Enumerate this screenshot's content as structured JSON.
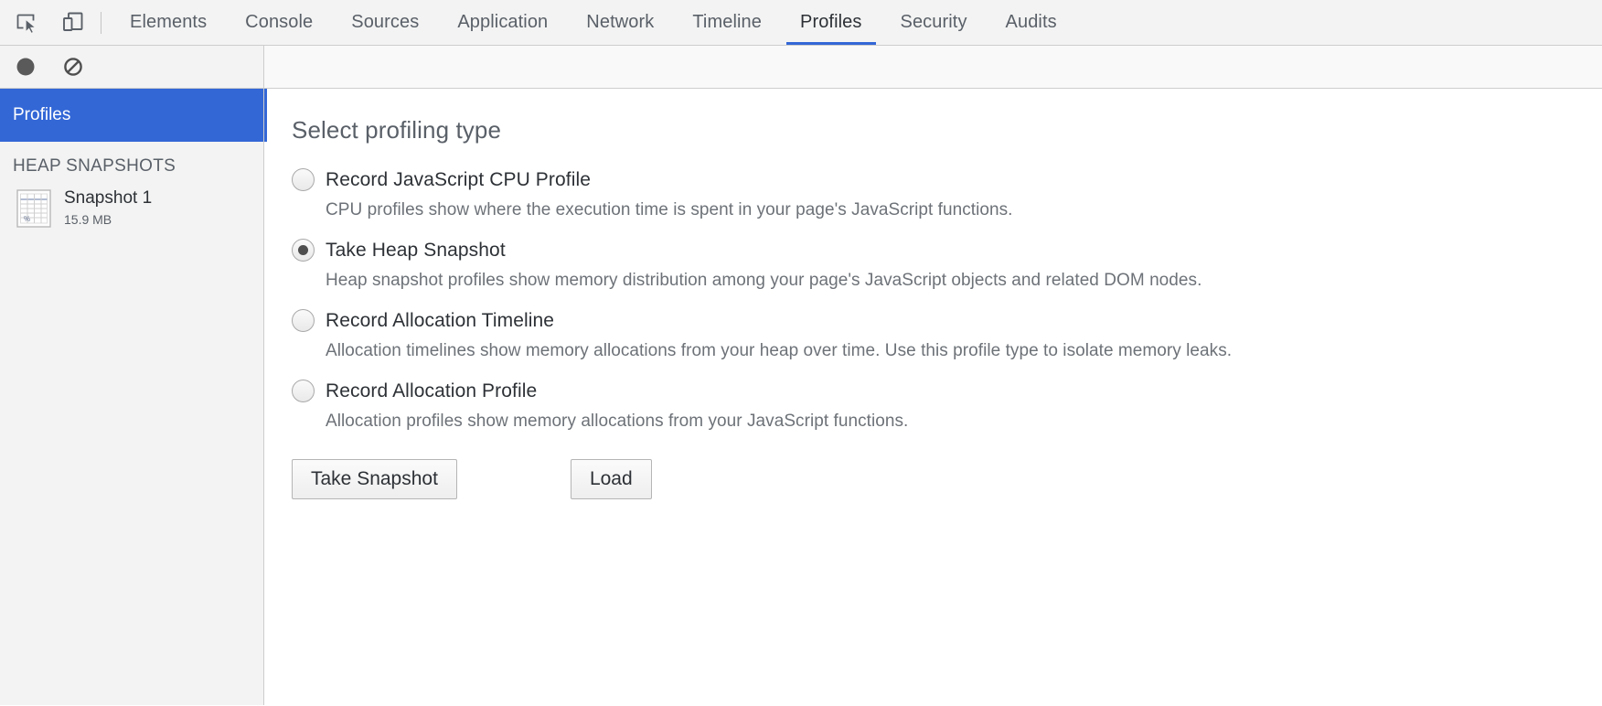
{
  "toolbar": {
    "icons": [
      {
        "name": "inspect-element-icon",
        "title": "Inspect element"
      },
      {
        "name": "device-toolbar-icon",
        "title": "Toggle device toolbar"
      }
    ],
    "tabs": [
      {
        "label": "Elements",
        "active": false
      },
      {
        "label": "Console",
        "active": false
      },
      {
        "label": "Sources",
        "active": false
      },
      {
        "label": "Application",
        "active": false
      },
      {
        "label": "Network",
        "active": false
      },
      {
        "label": "Timeline",
        "active": false
      },
      {
        "label": "Profiles",
        "active": true
      },
      {
        "label": "Security",
        "active": false
      },
      {
        "label": "Audits",
        "active": false
      }
    ],
    "active_tab": "Profiles",
    "accent_color": "#3367d6"
  },
  "sub_toolbar": {
    "buttons": [
      {
        "name": "record-button",
        "icon": "record-circle-icon"
      },
      {
        "name": "clear-button",
        "icon": "clear-prohibited-icon"
      }
    ]
  },
  "sidebar": {
    "top_item": {
      "label": "Profiles",
      "selected": true
    },
    "section_title": "HEAP SNAPSHOTS",
    "snapshots": [
      {
        "title": "Snapshot 1",
        "size": "15.9 MB",
        "icon": "heap-snapshot-icon"
      }
    ]
  },
  "main": {
    "title": "Select profiling type",
    "options": [
      {
        "label": "Record JavaScript CPU Profile",
        "description": "CPU profiles show where the execution time is spent in your page's JavaScript functions.",
        "selected": false
      },
      {
        "label": "Take Heap Snapshot",
        "description": "Heap snapshot profiles show memory distribution among your page's JavaScript objects and related DOM nodes.",
        "selected": true
      },
      {
        "label": "Record Allocation Timeline",
        "description": "Allocation timelines show memory allocations from your heap over time. Use this profile type to isolate memory leaks.",
        "selected": false
      },
      {
        "label": "Record Allocation Profile",
        "description": "Allocation profiles show memory allocations from your JavaScript functions.",
        "selected": false
      }
    ],
    "primary_button": "Take Snapshot",
    "secondary_button": "Load"
  }
}
